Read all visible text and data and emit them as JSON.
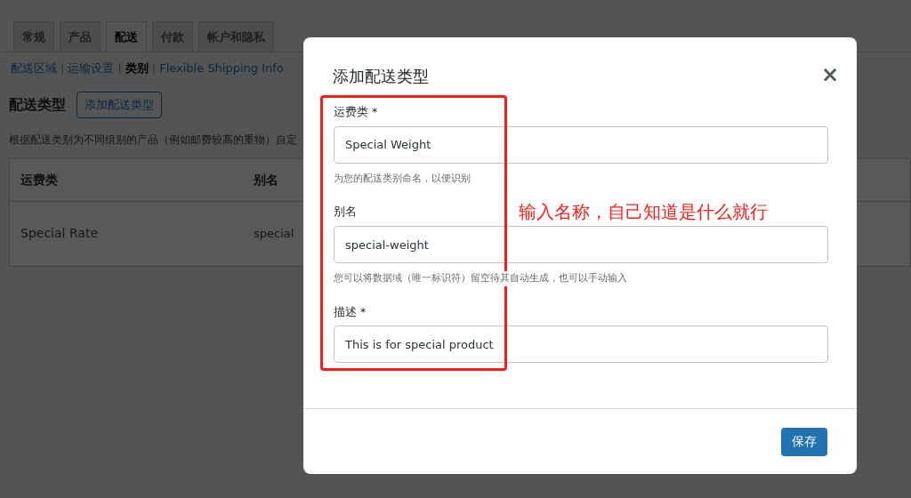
{
  "tabs": [
    {
      "label": "常规",
      "selected": false
    },
    {
      "label": "产品",
      "selected": false
    },
    {
      "label": "配送",
      "selected": true
    },
    {
      "label": "付款",
      "selected": false
    },
    {
      "label": "帐户和隐私",
      "selected": false
    }
  ],
  "subnav": [
    {
      "label": "配送区域",
      "selected": false
    },
    {
      "label": "运输设置",
      "selected": false
    },
    {
      "label": "类别",
      "selected": true
    },
    {
      "label": "Flexible Shipping Info",
      "selected": false
    }
  ],
  "subnav_separator": "|",
  "heading": "配送类型",
  "add_button": "添加配送类型",
  "description": "根据配送类别为不同组别的产品（例如邮费较高的重物）自定",
  "table": {
    "columns": [
      "运费类",
      "别名"
    ],
    "rows": [
      [
        "Special Rate",
        "special"
      ]
    ]
  },
  "modal": {
    "title": "添加配送类型",
    "close": "×",
    "fields": [
      {
        "label": "运费类 *",
        "value": "Special Weight",
        "help": "为您的配送类别命名，以便识别"
      },
      {
        "label": "别名",
        "value": "special-weight",
        "help": "您可以将数据域（唯一标识符）留空待其自动生成，也可以手动输入"
      },
      {
        "label": "描述 *",
        "value": "This is for special product"
      }
    ],
    "save_button": "保存"
  },
  "annotation": "输入名称，自己知道是什么就行"
}
